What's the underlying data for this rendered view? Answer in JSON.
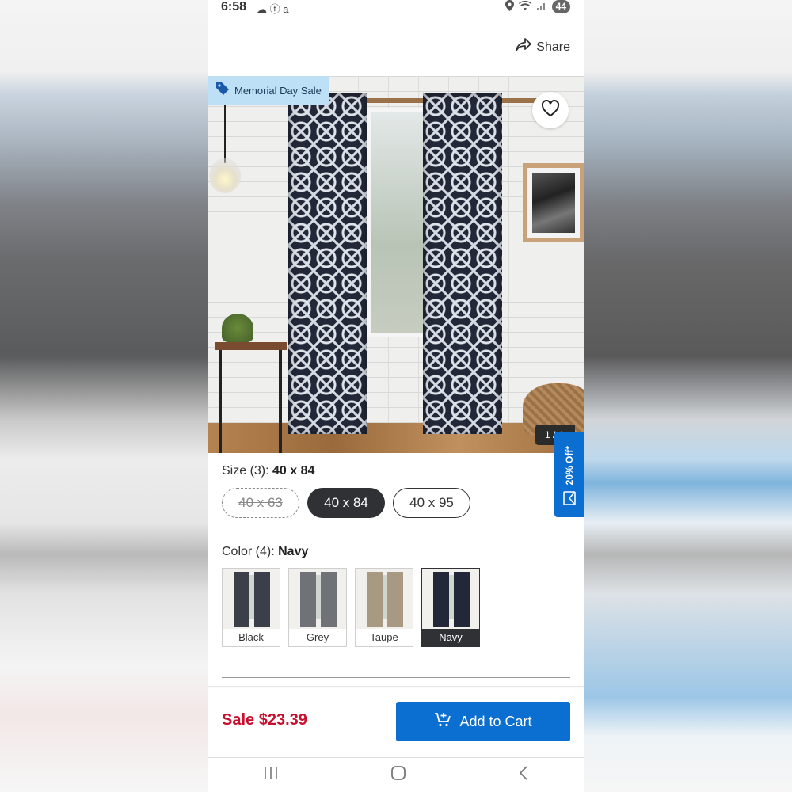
{
  "status_bar": {
    "time": "6:58",
    "left_icons": "☁ ⓕ ā",
    "battery": "44"
  },
  "header": {
    "share_label": "Share"
  },
  "product_image": {
    "badge_label": "Memorial Day Sale",
    "counter": "1 / 4"
  },
  "promo_tab": {
    "label": "20% Off*"
  },
  "size": {
    "label_prefix": "Size (3): ",
    "selected_value": "40 x 84",
    "options": [
      {
        "label": "40 x 63",
        "state": "unavailable"
      },
      {
        "label": "40 x 84",
        "state": "selected"
      },
      {
        "label": "40 x 95",
        "state": "available"
      }
    ]
  },
  "color": {
    "label_prefix": "Color (4): ",
    "selected_value": "Navy",
    "options": [
      {
        "label": "Black",
        "curtain_color": "#3a3f4a"
      },
      {
        "label": "Grey",
        "curtain_color": "#6f7276"
      },
      {
        "label": "Taupe",
        "curtain_color": "#a89a82"
      },
      {
        "label": "Navy",
        "curtain_color": "#232838"
      }
    ]
  },
  "purchase": {
    "price": "Sale $23.39",
    "add_to_cart_label": "Add to Cart"
  },
  "colors": {
    "accent": "#0a6fd1",
    "sale_red": "#c8102e",
    "badge_bg": "#bde0f7",
    "selected_dark": "#2f3135"
  },
  "icons": {
    "share": "share-arrow-icon",
    "tag": "tag-icon",
    "heart": "heart-outline-icon",
    "cart": "cart-plus-icon",
    "envelope": "envelope-icon"
  }
}
